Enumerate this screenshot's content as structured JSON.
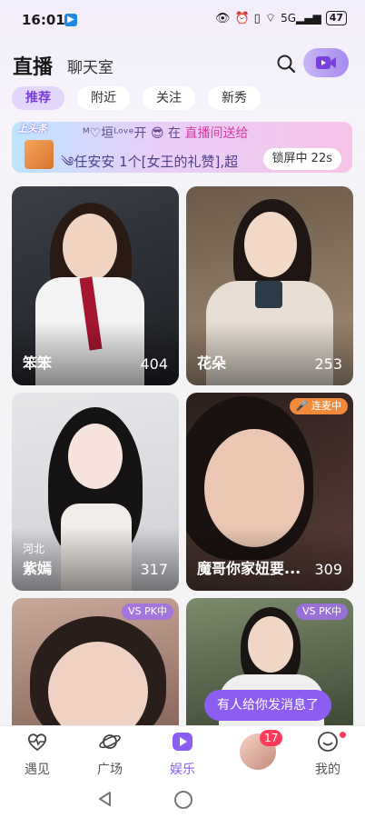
{
  "status_bar": {
    "time": "16:01",
    "battery": "47",
    "network": "5G"
  },
  "header": {
    "title": "直播",
    "subtitle": "聊天室"
  },
  "tabs": [
    {
      "label": "推荐",
      "active": true
    },
    {
      "label": "附近",
      "active": false
    },
    {
      "label": "关注",
      "active": false
    },
    {
      "label": "新秀",
      "active": false
    }
  ],
  "banner": {
    "tag": "上头条",
    "line1_prefix": "ᴹ♡垣ᴸᵒᵛᵉ开",
    "line1_middle": "在",
    "line1_highlight": "直播间送给",
    "line2": "༄任安安 1个[女王的礼赞],超",
    "lock_label": "锁屏中 22s"
  },
  "cards": [
    {
      "name": "笨笨",
      "count": "404",
      "location": "",
      "badge": ""
    },
    {
      "name": "花朵",
      "count": "253",
      "location": "",
      "badge": ""
    },
    {
      "name": "紫嫣",
      "count": "317",
      "location": "河北",
      "badge": ""
    },
    {
      "name": "魔哥你家妞要...",
      "count": "309",
      "location": "",
      "badge": "连麦中"
    },
    {
      "name": "",
      "count": "",
      "location": "",
      "badge": "PK中"
    },
    {
      "name": "",
      "count": "",
      "location": "",
      "badge": "PK中"
    }
  ],
  "toast": "有人给你发消息了",
  "bottom_nav": [
    {
      "label": "遇见",
      "icon": "heartbeat-icon",
      "active": false
    },
    {
      "label": "广场",
      "icon": "planet-icon",
      "active": false
    },
    {
      "label": "娱乐",
      "icon": "play-icon",
      "active": true
    },
    {
      "label": "",
      "icon": "avatar",
      "active": false
    },
    {
      "label": "我的",
      "icon": "smile-icon",
      "active": false
    }
  ],
  "avatar_badge": "17",
  "colors": {
    "accent": "#8b5df0",
    "tab_active_bg": "#e3d6fb",
    "badge_red": "#ff3b5c"
  }
}
